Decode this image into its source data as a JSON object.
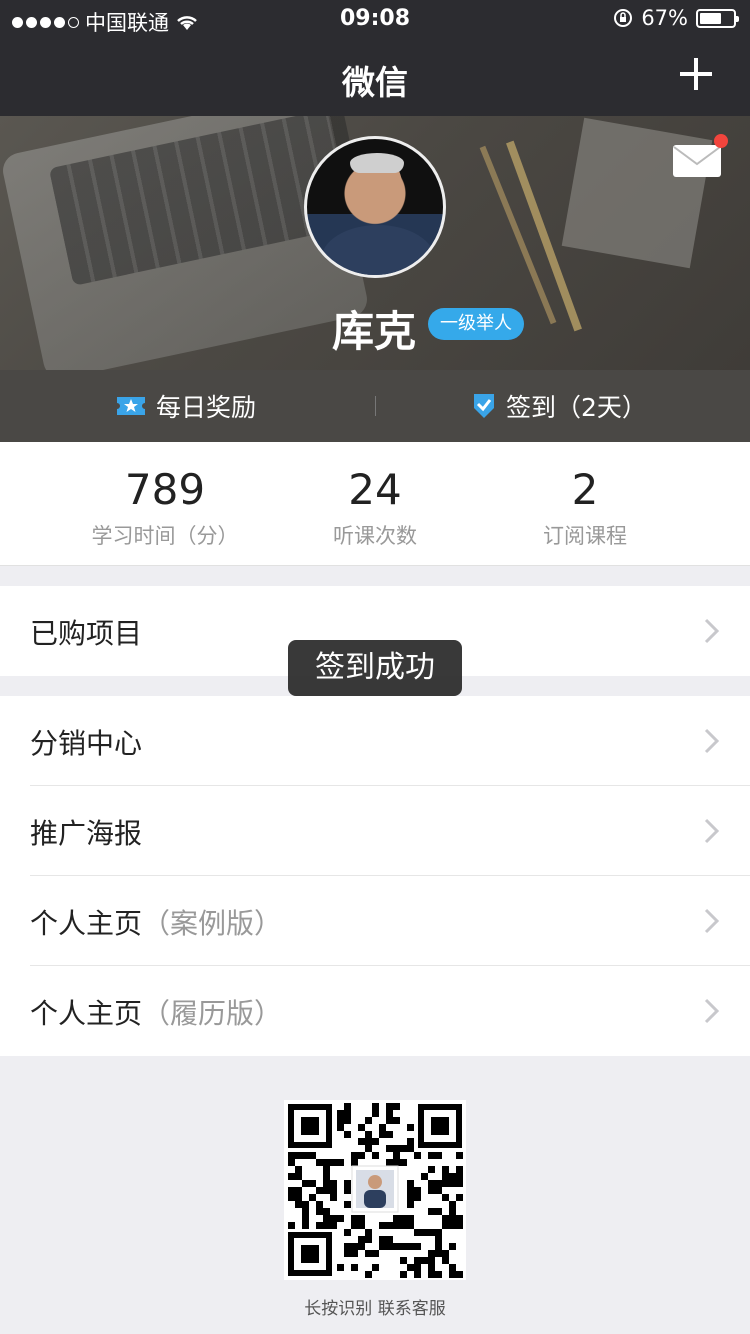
{
  "status_bar": {
    "carrier": "中国联通",
    "time": "09:08",
    "battery": "67%",
    "battery_level": 0.67
  },
  "navbar": {
    "title": "微信",
    "plus_icon": "plus-icon"
  },
  "profile": {
    "name": "库克",
    "badge": "一级举人"
  },
  "rewards": {
    "daily": "每日奖励",
    "signin": "签到（2天）"
  },
  "stats": [
    {
      "value": "789",
      "label": "学习时间（分）"
    },
    {
      "value": "24",
      "label": "听课次数"
    },
    {
      "value": "2",
      "label": "订阅课程"
    }
  ],
  "menu": {
    "purchased": "已购项目",
    "distribution": "分销中心",
    "poster": "推广海报",
    "home_case": "个人主页",
    "home_case_suffix": "（案例版）",
    "home_resume": "个人主页",
    "home_resume_suffix": "（履历版）"
  },
  "toast": "签到成功",
  "qr_caption": "长按识别 联系客服",
  "colors": {
    "bar_bg": "#2c2c30",
    "badge_blue": "#35a9ea",
    "notification_red": "#f2453d"
  }
}
